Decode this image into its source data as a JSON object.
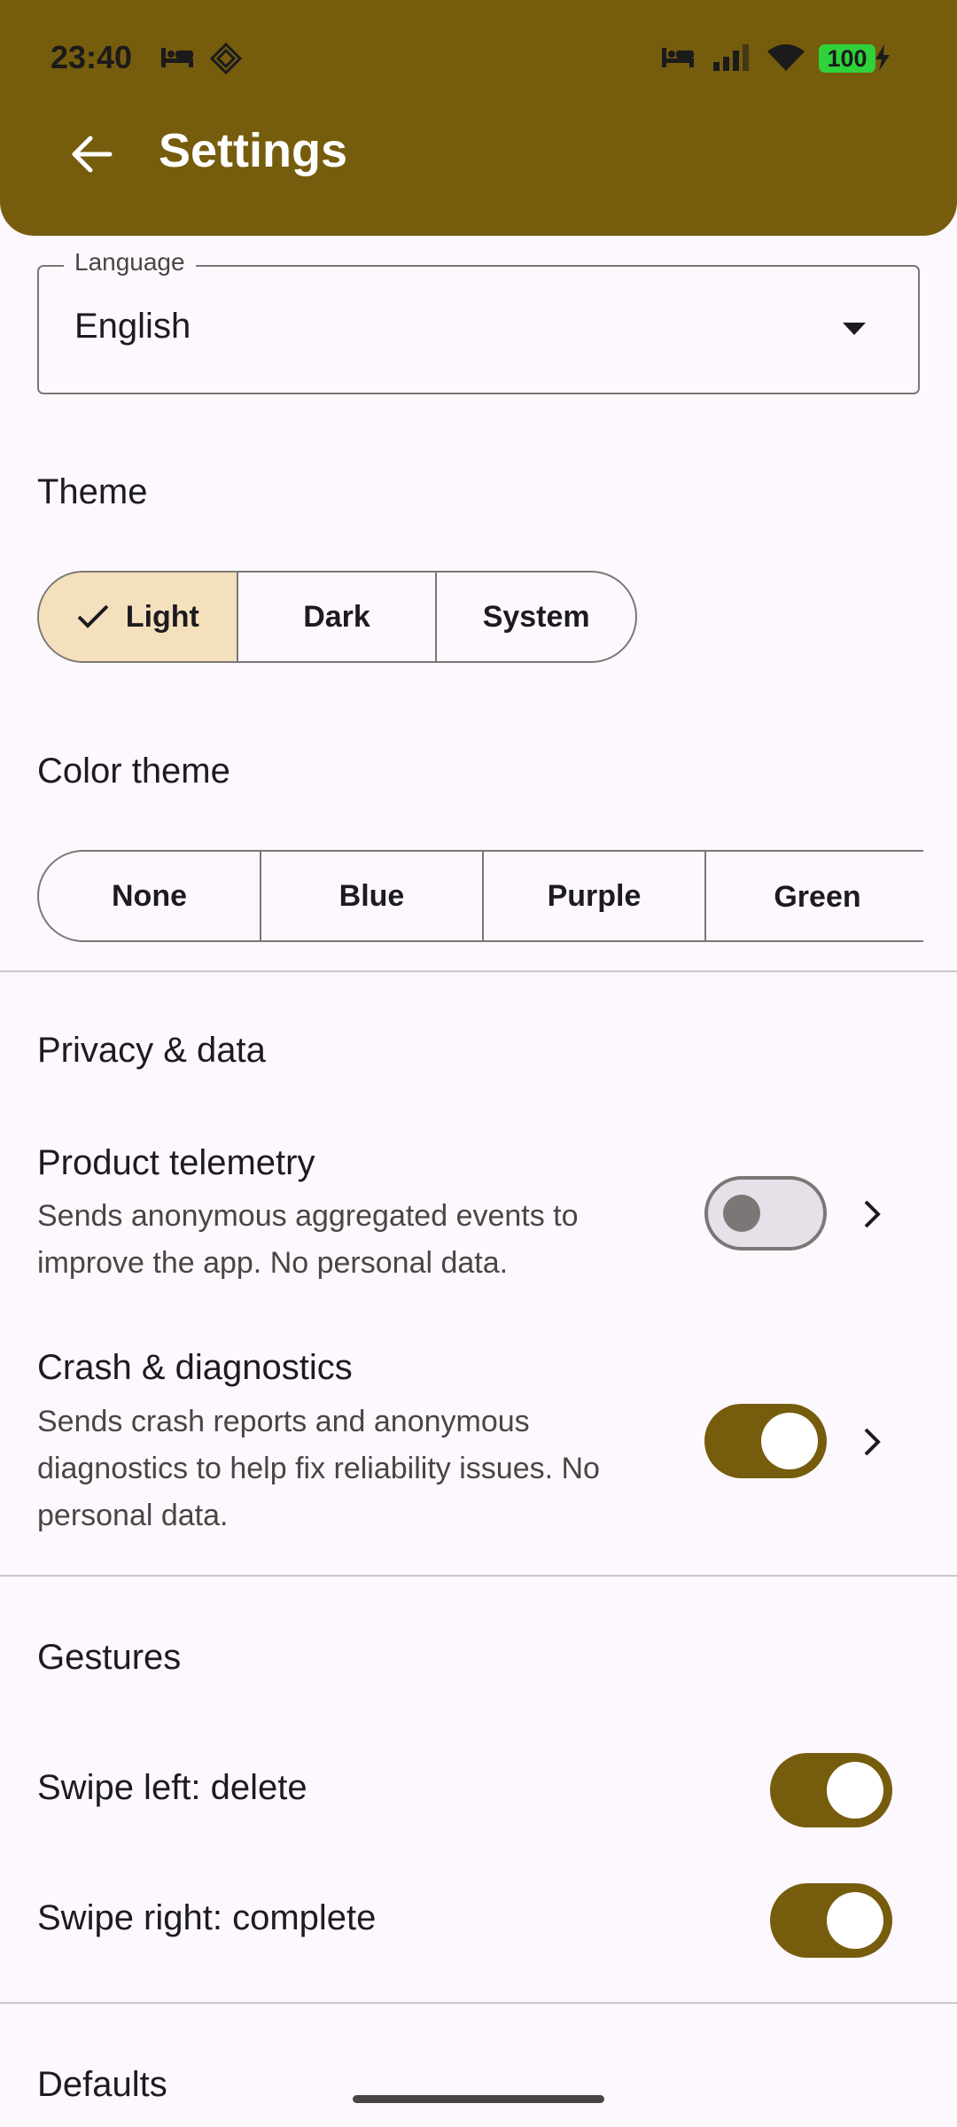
{
  "status_bar": {
    "time": "23:40",
    "battery": "100",
    "icons": [
      "bed-icon",
      "sync-icon",
      "bed-icon",
      "signal-icon",
      "wifi-icon",
      "charging-icon"
    ]
  },
  "app_bar": {
    "title": "Settings",
    "back_icon": "arrow-left-icon",
    "color": "#765c0d"
  },
  "language": {
    "label": "Language",
    "value": "English"
  },
  "theme": {
    "title": "Theme",
    "options": [
      "Light",
      "Dark",
      "System"
    ],
    "selected": "Light"
  },
  "color_theme": {
    "title": "Color theme",
    "options": [
      "None",
      "Blue",
      "Purple",
      "Green"
    ]
  },
  "privacy": {
    "title": "Privacy & data",
    "items": [
      {
        "title": "Product telemetry",
        "subtitle": "Sends anonymous aggregated events to improve the app. No personal data.",
        "enabled": false
      },
      {
        "title": "Crash & diagnostics",
        "subtitle": "Sends crash reports and anonymous diagnostics to help fix reliability issues. No personal data.",
        "enabled": true
      }
    ]
  },
  "gestures": {
    "title": "Gestures",
    "items": [
      {
        "title": "Swipe left: delete",
        "enabled": true
      },
      {
        "title": "Swipe right: complete",
        "enabled": true
      }
    ]
  },
  "defaults": {
    "title": "Defaults"
  },
  "colors": {
    "accent": "#765c0d",
    "selected_segment": "#f5e0bd",
    "background": "#fdf8fd"
  }
}
